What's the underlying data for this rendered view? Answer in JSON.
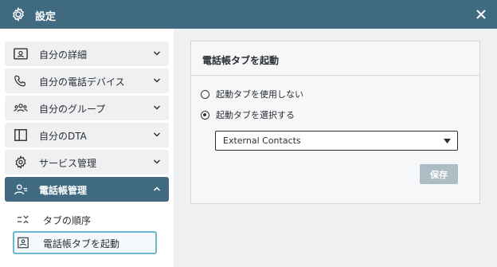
{
  "window": {
    "title": "設定",
    "icon": "gear-icon",
    "close_icon": "close-icon"
  },
  "sidebar": {
    "items": [
      {
        "label": "自分の詳細",
        "icon": "id-card-icon",
        "expanded": false
      },
      {
        "label": "自分の電話デバイス",
        "icon": "phone-icon",
        "expanded": false
      },
      {
        "label": "自分のグループ",
        "icon": "group-icon",
        "expanded": false
      },
      {
        "label": "自分のDTA",
        "icon": "panel-icon",
        "expanded": false
      },
      {
        "label": "サービス管理",
        "icon": "service-gear-icon",
        "expanded": false
      },
      {
        "label": "電話帳管理",
        "icon": "contacts-icon",
        "expanded": true
      }
    ],
    "subitems": [
      {
        "label": "タブの順序",
        "icon": "tab-order-icon",
        "selected": false
      },
      {
        "label": "電話帳タブを起動",
        "icon": "contact-card-icon",
        "selected": true
      }
    ]
  },
  "panel": {
    "title": "電話帳タブを起動",
    "options": [
      {
        "label": "起動タブを使用しない",
        "checked": false
      },
      {
        "label": "起動タブを選択する",
        "checked": true
      }
    ],
    "select": {
      "value": "External Contacts"
    },
    "save_label": "保存"
  },
  "colors": {
    "header": "#3f6a80",
    "active_nav": "#3f6a80",
    "selected_border": "#68b8d0",
    "save_disabled": "#aebcc5"
  }
}
